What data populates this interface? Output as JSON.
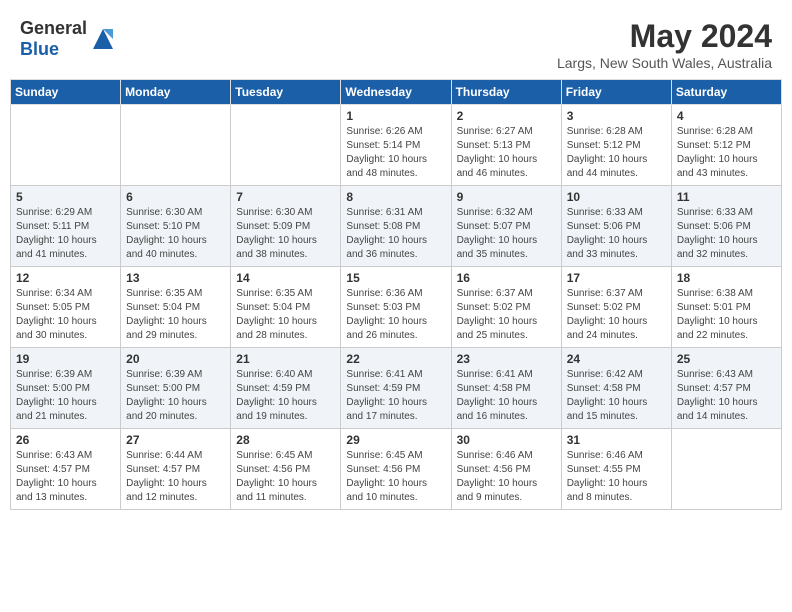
{
  "header": {
    "logo_general": "General",
    "logo_blue": "Blue",
    "month_year": "May 2024",
    "location": "Largs, New South Wales, Australia"
  },
  "weekdays": [
    "Sunday",
    "Monday",
    "Tuesday",
    "Wednesday",
    "Thursday",
    "Friday",
    "Saturday"
  ],
  "weeks": [
    [
      {
        "day": "",
        "info": ""
      },
      {
        "day": "",
        "info": ""
      },
      {
        "day": "",
        "info": ""
      },
      {
        "day": "1",
        "info": "Sunrise: 6:26 AM\nSunset: 5:14 PM\nDaylight: 10 hours\nand 48 minutes."
      },
      {
        "day": "2",
        "info": "Sunrise: 6:27 AM\nSunset: 5:13 PM\nDaylight: 10 hours\nand 46 minutes."
      },
      {
        "day": "3",
        "info": "Sunrise: 6:28 AM\nSunset: 5:12 PM\nDaylight: 10 hours\nand 44 minutes."
      },
      {
        "day": "4",
        "info": "Sunrise: 6:28 AM\nSunset: 5:12 PM\nDaylight: 10 hours\nand 43 minutes."
      }
    ],
    [
      {
        "day": "5",
        "info": "Sunrise: 6:29 AM\nSunset: 5:11 PM\nDaylight: 10 hours\nand 41 minutes."
      },
      {
        "day": "6",
        "info": "Sunrise: 6:30 AM\nSunset: 5:10 PM\nDaylight: 10 hours\nand 40 minutes."
      },
      {
        "day": "7",
        "info": "Sunrise: 6:30 AM\nSunset: 5:09 PM\nDaylight: 10 hours\nand 38 minutes."
      },
      {
        "day": "8",
        "info": "Sunrise: 6:31 AM\nSunset: 5:08 PM\nDaylight: 10 hours\nand 36 minutes."
      },
      {
        "day": "9",
        "info": "Sunrise: 6:32 AM\nSunset: 5:07 PM\nDaylight: 10 hours\nand 35 minutes."
      },
      {
        "day": "10",
        "info": "Sunrise: 6:33 AM\nSunset: 5:06 PM\nDaylight: 10 hours\nand 33 minutes."
      },
      {
        "day": "11",
        "info": "Sunrise: 6:33 AM\nSunset: 5:06 PM\nDaylight: 10 hours\nand 32 minutes."
      }
    ],
    [
      {
        "day": "12",
        "info": "Sunrise: 6:34 AM\nSunset: 5:05 PM\nDaylight: 10 hours\nand 30 minutes."
      },
      {
        "day": "13",
        "info": "Sunrise: 6:35 AM\nSunset: 5:04 PM\nDaylight: 10 hours\nand 29 minutes."
      },
      {
        "day": "14",
        "info": "Sunrise: 6:35 AM\nSunset: 5:04 PM\nDaylight: 10 hours\nand 28 minutes."
      },
      {
        "day": "15",
        "info": "Sunrise: 6:36 AM\nSunset: 5:03 PM\nDaylight: 10 hours\nand 26 minutes."
      },
      {
        "day": "16",
        "info": "Sunrise: 6:37 AM\nSunset: 5:02 PM\nDaylight: 10 hours\nand 25 minutes."
      },
      {
        "day": "17",
        "info": "Sunrise: 6:37 AM\nSunset: 5:02 PM\nDaylight: 10 hours\nand 24 minutes."
      },
      {
        "day": "18",
        "info": "Sunrise: 6:38 AM\nSunset: 5:01 PM\nDaylight: 10 hours\nand 22 minutes."
      }
    ],
    [
      {
        "day": "19",
        "info": "Sunrise: 6:39 AM\nSunset: 5:00 PM\nDaylight: 10 hours\nand 21 minutes."
      },
      {
        "day": "20",
        "info": "Sunrise: 6:39 AM\nSunset: 5:00 PM\nDaylight: 10 hours\nand 20 minutes."
      },
      {
        "day": "21",
        "info": "Sunrise: 6:40 AM\nSunset: 4:59 PM\nDaylight: 10 hours\nand 19 minutes."
      },
      {
        "day": "22",
        "info": "Sunrise: 6:41 AM\nSunset: 4:59 PM\nDaylight: 10 hours\nand 17 minutes."
      },
      {
        "day": "23",
        "info": "Sunrise: 6:41 AM\nSunset: 4:58 PM\nDaylight: 10 hours\nand 16 minutes."
      },
      {
        "day": "24",
        "info": "Sunrise: 6:42 AM\nSunset: 4:58 PM\nDaylight: 10 hours\nand 15 minutes."
      },
      {
        "day": "25",
        "info": "Sunrise: 6:43 AM\nSunset: 4:57 PM\nDaylight: 10 hours\nand 14 minutes."
      }
    ],
    [
      {
        "day": "26",
        "info": "Sunrise: 6:43 AM\nSunset: 4:57 PM\nDaylight: 10 hours\nand 13 minutes."
      },
      {
        "day": "27",
        "info": "Sunrise: 6:44 AM\nSunset: 4:57 PM\nDaylight: 10 hours\nand 12 minutes."
      },
      {
        "day": "28",
        "info": "Sunrise: 6:45 AM\nSunset: 4:56 PM\nDaylight: 10 hours\nand 11 minutes."
      },
      {
        "day": "29",
        "info": "Sunrise: 6:45 AM\nSunset: 4:56 PM\nDaylight: 10 hours\nand 10 minutes."
      },
      {
        "day": "30",
        "info": "Sunrise: 6:46 AM\nSunset: 4:56 PM\nDaylight: 10 hours\nand 9 minutes."
      },
      {
        "day": "31",
        "info": "Sunrise: 6:46 AM\nSunset: 4:55 PM\nDaylight: 10 hours\nand 8 minutes."
      },
      {
        "day": "",
        "info": ""
      }
    ]
  ]
}
